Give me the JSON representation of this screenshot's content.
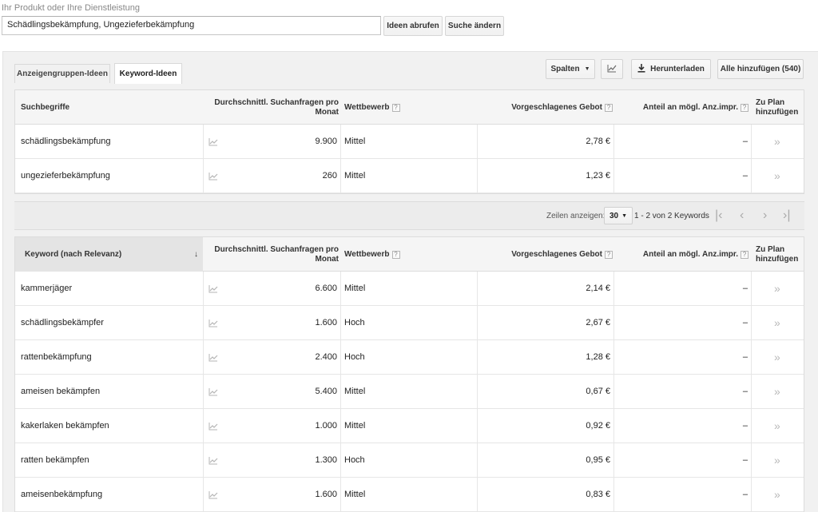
{
  "search": {
    "label": "Ihr Produkt oder Ihre Dienstleistung",
    "value": "Schädlingsbekämpfung, Ungezieferbekämpfung",
    "get_ideas_label": "Ideen abrufen",
    "modify_search_label": "Suche ändern"
  },
  "tabs": [
    {
      "label": "Anzeigengruppen-Ideen",
      "active": false
    },
    {
      "label": "Keyword-Ideen",
      "active": true
    }
  ],
  "toolbar": {
    "columns_label": "Spalten",
    "download_label": "Herunterladen",
    "add_all_label": "Alle hinzufügen (540)"
  },
  "search_terms_table": {
    "headers": {
      "keyword": "Suchbegriffe",
      "avg_searches": "Durchschnittl. Suchanfragen pro Monat",
      "competition": "Wettbewerb",
      "suggested_bid": "Vorgeschlagenes Gebot",
      "impr_share": "Anteil an mögl. Anz.impr.",
      "add_to_plan": "Zu Plan hinzufügen"
    },
    "rows": [
      {
        "keyword": "schädlingsbekämpfung",
        "searches": "9.900",
        "competition": "Mittel",
        "bid": "2,78 €",
        "share": "–"
      },
      {
        "keyword": "ungezieferbekämpfung",
        "searches": "260",
        "competition": "Mittel",
        "bid": "1,23 €",
        "share": "–"
      }
    ]
  },
  "pagination": {
    "rows_label": "Zeilen anzeigen:",
    "rows_value": "30",
    "range_text": "1 - 2 von 2 Keywords"
  },
  "keyword_ideas_table": {
    "headers": {
      "keyword": "Keyword (nach Relevanz)",
      "avg_searches": "Durchschnittl. Suchanfragen pro Monat",
      "competition": "Wettbewerb",
      "suggested_bid": "Vorgeschlagenes Gebot",
      "impr_share": "Anteil an mögl. Anz.impr.",
      "add_to_plan": "Zu Plan hinzufügen"
    },
    "rows": [
      {
        "keyword": "kammerjäger",
        "searches": "6.600",
        "competition": "Mittel",
        "bid": "2,14 €",
        "share": "–"
      },
      {
        "keyword": "schädlingsbekämpfer",
        "searches": "1.600",
        "competition": "Hoch",
        "bid": "2,67 €",
        "share": "–"
      },
      {
        "keyword": "rattenbekämpfung",
        "searches": "2.400",
        "competition": "Hoch",
        "bid": "1,28 €",
        "share": "–"
      },
      {
        "keyword": "ameisen bekämpfen",
        "searches": "5.400",
        "competition": "Mittel",
        "bid": "0,67 €",
        "share": "–"
      },
      {
        "keyword": "kakerlaken bekämpfen",
        "searches": "1.000",
        "competition": "Mittel",
        "bid": "0,92 €",
        "share": "–"
      },
      {
        "keyword": "ratten bekämpfen",
        "searches": "1.300",
        "competition": "Hoch",
        "bid": "0,95 €",
        "share": "–"
      },
      {
        "keyword": "ameisenbekämpfung",
        "searches": "1.600",
        "competition": "Mittel",
        "bid": "0,83 €",
        "share": "–"
      }
    ]
  },
  "icons": {
    "trend": "trend-chart-icon",
    "add": "add-to-plan-icon",
    "download": "download-icon",
    "chart": "chart-icon",
    "help": "help-icon",
    "sort": "sort-down-icon"
  }
}
